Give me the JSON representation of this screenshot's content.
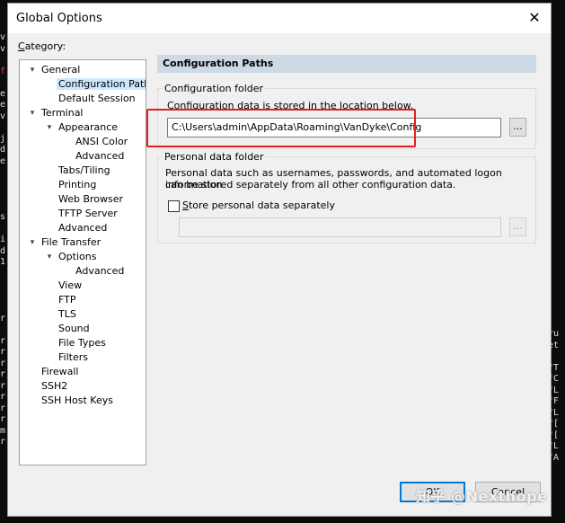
{
  "terminal": {
    "left_lines": [
      "v",
      "v",
      "",
      "f",
      "",
      "e",
      "e",
      "v",
      "",
      "j",
      "d",
      "e",
      "",
      "",
      "",
      "",
      "s",
      "",
      "i",
      "d",
      "1",
      "",
      "",
      "",
      "",
      "r",
      "",
      "r",
      "r",
      "r",
      "r",
      "r",
      "r",
      "r",
      "r",
      "m",
      "r"
    ],
    "right_lines": [
      "-ru",
      "het",
      "",
      "=\"T",
      "=\"C",
      "=\"L",
      "=\"F",
      "=\"L",
      "=\"[",
      "=\"[",
      "=\"L",
      "=\"A"
    ]
  },
  "dialog": {
    "title": "Global Options",
    "close_icon": "close-icon",
    "category_label": "ategory:",
    "category_accel": "C"
  },
  "tree": {
    "items": [
      {
        "label": "General",
        "expander": "▾"
      },
      {
        "label": "Configuration Paths",
        "selected": true
      },
      {
        "label": "Default Session"
      },
      {
        "label": "Terminal",
        "expander": "▾"
      },
      {
        "label": "Appearance",
        "expander": "▾"
      },
      {
        "label": "ANSI Color"
      },
      {
        "label": "Advanced"
      },
      {
        "label": "Tabs/Tiling"
      },
      {
        "label": "Printing"
      },
      {
        "label": "Web Browser"
      },
      {
        "label": "TFTP Server"
      },
      {
        "label": "Advanced"
      },
      {
        "label": "File Transfer",
        "expander": "▾"
      },
      {
        "label": "Options",
        "expander": "▾"
      },
      {
        "label": "Advanced"
      },
      {
        "label": "View"
      },
      {
        "label": "FTP"
      },
      {
        "label": "TLS"
      },
      {
        "label": "Sound"
      },
      {
        "label": "File Types"
      },
      {
        "label": "Filters"
      },
      {
        "label": "Firewall"
      },
      {
        "label": "SSH2"
      },
      {
        "label": "SSH Host Keys"
      }
    ]
  },
  "panel": {
    "header": "Configuration Paths",
    "config_folder": {
      "title": "Configuration folder",
      "description": "Configuration data is stored in the location below.",
      "path": "C:\\Users\\admin\\AppData\\Roaming\\VanDyke\\Config",
      "browse_label": "..."
    },
    "personal_folder": {
      "title": "Personal data folder",
      "description_line1": "Personal data such as usernames, passwords, and automated logon information",
      "description_line2": "can be stored separately from all other configuration data.",
      "checkbox_label": "Store personal data separately",
      "checkbox_checked": false,
      "path": "",
      "browse_label": "..."
    }
  },
  "buttons": {
    "ok": "OK",
    "cancel": "Cancel"
  },
  "watermark": "知乎 @Nexthope",
  "colors": {
    "selection": "#cce8ff",
    "header_bar": "#cdd9e5",
    "highlight_box": "#e02020",
    "default_button": "#0078d7"
  }
}
